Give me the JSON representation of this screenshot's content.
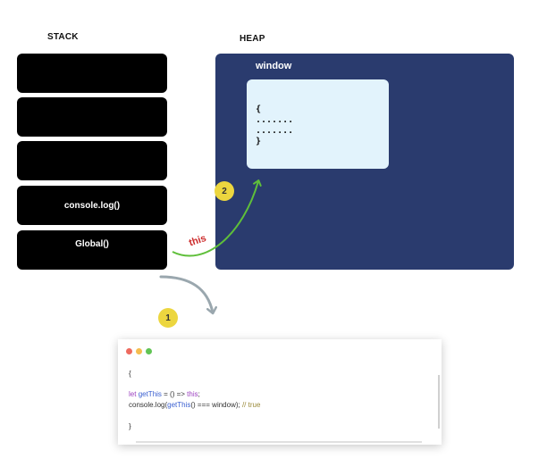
{
  "labels": {
    "stack": "STACK",
    "heap": "HEAP"
  },
  "stack": {
    "frames": [
      "",
      "",
      "",
      "console.log()",
      "Global()"
    ]
  },
  "heap": {
    "object_name": "window",
    "object_lines": [
      "{",
      ".......",
      ".......",
      "}"
    ]
  },
  "badges": {
    "step1": "1",
    "step2": "2"
  },
  "arrow_label": "this",
  "code": {
    "line1": "{",
    "line2_kw": "let",
    "line2_fn": "getThis",
    "line2_rest": " = () => ",
    "line2_kw2": "this",
    "line2_end": ";",
    "line3_a": "console.log(",
    "line3_fn": "getThis",
    "line3_b": "() === window); ",
    "line3_comment": "// true",
    "line4": "}"
  },
  "colors": {
    "heap_bg": "#2a3b6e",
    "object_bg": "#e2f3fc",
    "badge": "#ecd63f",
    "arrow_green": "#5fbf3a",
    "arrow_gray": "#9aa7ae",
    "this_red": "#cc2a2a",
    "dot_red": "#ee6a5e",
    "dot_yellow": "#f5bd4f",
    "dot_green": "#61c454"
  }
}
